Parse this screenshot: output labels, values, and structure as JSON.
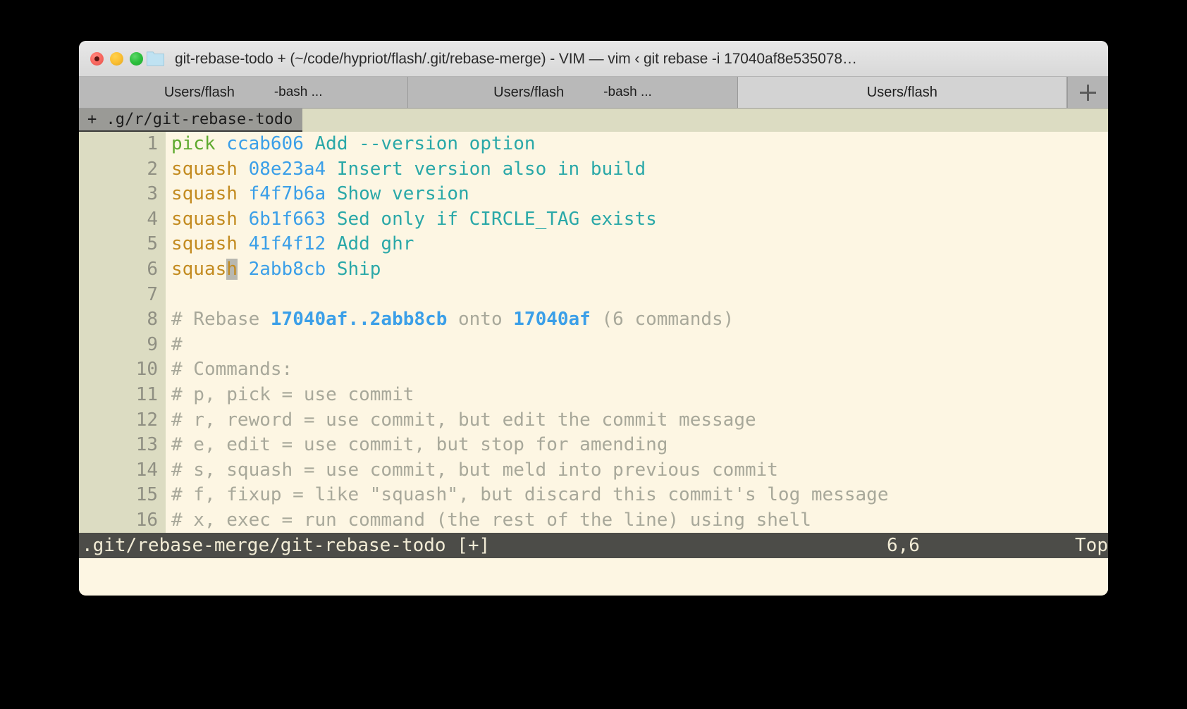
{
  "window": {
    "title": "git-rebase-todo + (~/code/hypriot/flash/.git/rebase-merge) - VIM — vim ‹ git rebase -i 17040af8e535078…",
    "traffic_lights": {
      "close": "close-button",
      "minimize": "minimize-button",
      "maximize": "maximize-button"
    },
    "folder_icon": "folder-icon"
  },
  "tabbar": {
    "new_tab_label": "+",
    "tabs": [
      {
        "title": "Users/flash",
        "sub": "-bash ...",
        "active": false
      },
      {
        "title": "Users/flash",
        "sub": "-bash ...",
        "active": false
      },
      {
        "title": "Users/flash",
        "sub": "",
        "active": true
      }
    ]
  },
  "vim": {
    "tabline": {
      "label": "+ .g/r/git-rebase-todo"
    },
    "statusline": {
      "file": ".git/rebase-merge/git-rebase-todo [+]",
      "position": "6,6",
      "scroll": "Top"
    },
    "lines": [
      {
        "n": "1",
        "type": "todo",
        "cmd": "pick",
        "hash": "ccab606",
        "msg": "Add --version option"
      },
      {
        "n": "2",
        "type": "todo",
        "cmd": "squash",
        "hash": "08e23a4",
        "msg": "Insert version also in build"
      },
      {
        "n": "3",
        "type": "todo",
        "cmd": "squash",
        "hash": "f4f7b6a",
        "msg": "Show version"
      },
      {
        "n": "4",
        "type": "todo",
        "cmd": "squash",
        "hash": "6b1f663",
        "msg": "Sed only if CIRCLE_TAG exists"
      },
      {
        "n": "5",
        "type": "todo",
        "cmd": "squash",
        "hash": "41f4f12",
        "msg": "Add ghr"
      },
      {
        "n": "6",
        "type": "todo-cursor",
        "cmd": "squash",
        "hash": "2abb8cb",
        "msg": "Ship",
        "cursor_index": 5
      },
      {
        "n": "7",
        "type": "blank",
        "text": ""
      },
      {
        "n": "8",
        "type": "rebase-header",
        "pre": "# Rebase ",
        "range": "17040af..2abb8cb",
        "mid": " onto ",
        "onto": "17040af",
        "post": " (6 commands)"
      },
      {
        "n": "9",
        "type": "comment",
        "text": "#"
      },
      {
        "n": "10",
        "type": "comment",
        "text": "# Commands:"
      },
      {
        "n": "11",
        "type": "comment",
        "text": "# p, pick = use commit"
      },
      {
        "n": "12",
        "type": "comment",
        "text": "# r, reword = use commit, but edit the commit message"
      },
      {
        "n": "13",
        "type": "comment",
        "text": "# e, edit = use commit, but stop for amending"
      },
      {
        "n": "14",
        "type": "comment",
        "text": "# s, squash = use commit, but meld into previous commit"
      },
      {
        "n": "15",
        "type": "comment",
        "text": "# f, fixup = like \"squash\", but discard this commit's log message"
      },
      {
        "n": "16",
        "type": "comment",
        "text": "# x, exec = run command (the rest of the line) using shell"
      }
    ]
  },
  "colors": {
    "background": "#fdf6e3",
    "gutter": "#dcdcc2",
    "pick": "#5faa2f",
    "squash": "#c38b20",
    "hash": "#3b9fe8",
    "message": "#2aa8a8",
    "comment": "#a8a89a",
    "statusline_bg": "#4c4c48",
    "statusline_fg": "#f2ecd6"
  }
}
